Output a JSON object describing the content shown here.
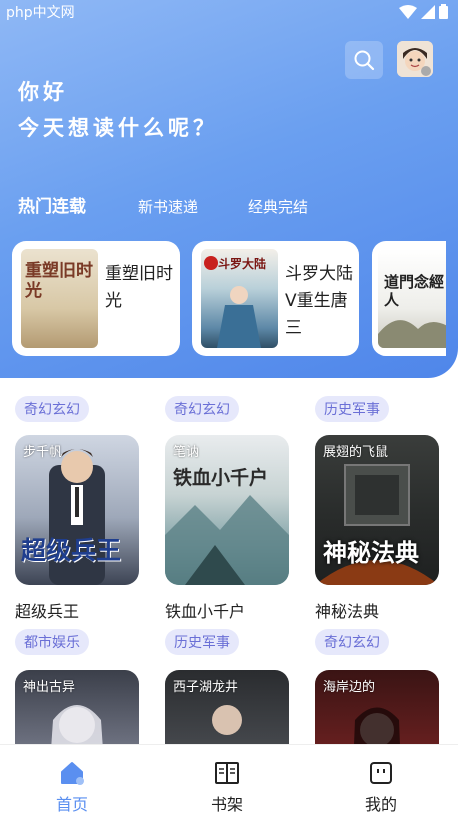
{
  "status_bar": {
    "watermark": "中文网",
    "watermark_prefix": "php"
  },
  "greeting": {
    "line1": "你好",
    "line2": "今天想读什么呢？"
  },
  "tabs": [
    {
      "label": "热门连载",
      "active": true
    },
    {
      "label": "新书速递",
      "active": false
    },
    {
      "label": "经典完结",
      "active": false
    }
  ],
  "featured": [
    {
      "title": "重塑旧时光",
      "cover_text": "重塑旧时光"
    },
    {
      "title": "斗罗大陆V重生唐三",
      "cover_text": "斗罗大陆"
    },
    {
      "title": "",
      "cover_text": "道門念經人"
    }
  ],
  "partial_row_tags": [
    "奇幻玄幻",
    "奇幻玄幻",
    "历史军事"
  ],
  "books": [
    {
      "author": "步千帆",
      "name": "超级兵王",
      "tag": "都市娱乐",
      "cover_text": "超级兵王"
    },
    {
      "author": "笔讷",
      "name": "铁血小千户",
      "tag": "历史军事",
      "cover_text": "铁血小千户"
    },
    {
      "author": "展翅的飞鼠",
      "name": "神秘法典",
      "tag": "奇幻玄幻",
      "cover_text": "神秘法典"
    },
    {
      "author": "神出古异",
      "name": "",
      "tag": "",
      "cover_text": ""
    },
    {
      "author": "西子湖龙井",
      "name": "",
      "tag": "",
      "cover_text": ""
    },
    {
      "author": "海岸边的",
      "name": "",
      "tag": "",
      "cover_text": ""
    }
  ],
  "bottom_nav": [
    {
      "label": "首页",
      "icon": "home-icon",
      "active": true
    },
    {
      "label": "书架",
      "icon": "book-icon",
      "active": false
    },
    {
      "label": "我的",
      "icon": "profile-icon",
      "active": false
    }
  ],
  "colors": {
    "accent": "#5a8ff0",
    "tag_bg": "#e6e8fb",
    "tag_text": "#6a6fd6"
  }
}
